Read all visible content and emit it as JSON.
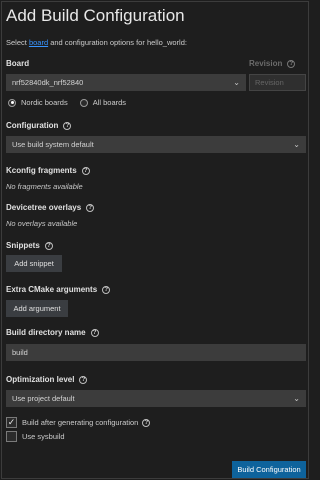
{
  "title": "Add Build Configuration",
  "subtitle": {
    "prefix": "Select ",
    "link": "board",
    "suffix": " and configuration options for hello_world:"
  },
  "board": {
    "label": "Board",
    "value": "nrf52840dk_nrf52840",
    "revision_label": "Revision",
    "revision_placeholder": "Revision",
    "radios": [
      {
        "label": "Nordic boards",
        "selected": true
      },
      {
        "label": "All boards",
        "selected": false
      }
    ]
  },
  "configuration": {
    "label": "Configuration",
    "value": "Use build system default"
  },
  "kconfig": {
    "label": "Kconfig fragments",
    "note": "No fragments available"
  },
  "devicetree": {
    "label": "Devicetree overlays",
    "note": "No overlays available"
  },
  "snippets": {
    "label": "Snippets",
    "button": "Add snippet"
  },
  "cmake": {
    "label": "Extra CMake arguments",
    "button": "Add argument"
  },
  "build_dir": {
    "label": "Build directory name",
    "value": "build"
  },
  "optimization": {
    "label": "Optimization level",
    "value": "Use project default"
  },
  "options": {
    "build_after": {
      "label": "Build after generating configuration",
      "checked": true
    },
    "sysbuild": {
      "label": "Use sysbuild",
      "checked": false
    }
  },
  "submit": "Build Configuration",
  "icons": {
    "help": "?",
    "caret": "⌄",
    "check": "✓"
  }
}
